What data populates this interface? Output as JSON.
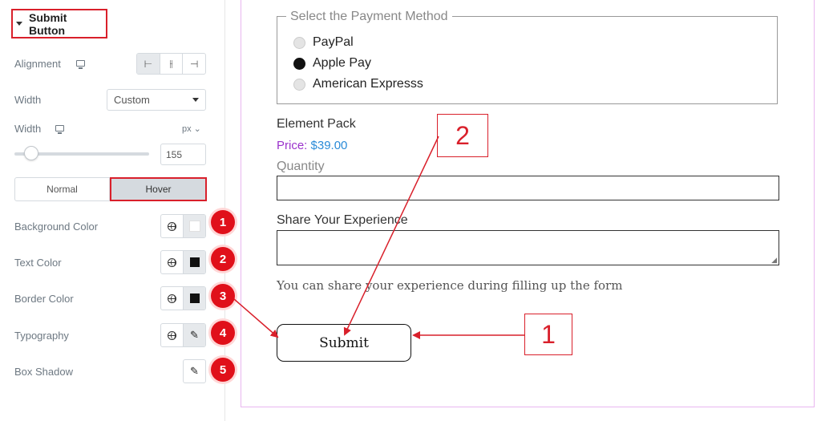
{
  "panel": {
    "section_title": "Submit Button",
    "alignment_label": "Alignment",
    "width_select_label": "Width",
    "width_select_value": "Custom",
    "width_label": "Width",
    "unit": "px",
    "width_value": "155",
    "tabs": [
      "Normal",
      "Hover"
    ],
    "active_tab": "Hover",
    "controls": [
      {
        "label": "Background Color",
        "badge": "1",
        "swatch": "#ffffff"
      },
      {
        "label": "Text Color",
        "badge": "2",
        "swatch": "#111111"
      },
      {
        "label": "Border Color",
        "badge": "3",
        "swatch": "#111111"
      },
      {
        "label": "Typography",
        "badge": "4"
      },
      {
        "label": "Box Shadow",
        "badge": "5"
      }
    ]
  },
  "form": {
    "payment_legend": "Select the Payment Method",
    "payment_options": [
      "PayPal",
      "Apple Pay",
      "American Expresss"
    ],
    "selected_option": "Apple Pay",
    "product_name": "Element Pack",
    "price_label": "Price:",
    "price_value": "$39.00",
    "quantity_label": "Quantity",
    "experience_label": "Share Your Experience",
    "hint": "You can share your experience during filling up the form",
    "submit_label": "Submit"
  },
  "callouts": [
    "1",
    "2"
  ],
  "colors": {
    "accent": "#d9202b",
    "badge": "#e0101a",
    "price_label": "#9b33cc",
    "price_value": "#2a8bd8",
    "preview_border": "#e9b6f0"
  }
}
